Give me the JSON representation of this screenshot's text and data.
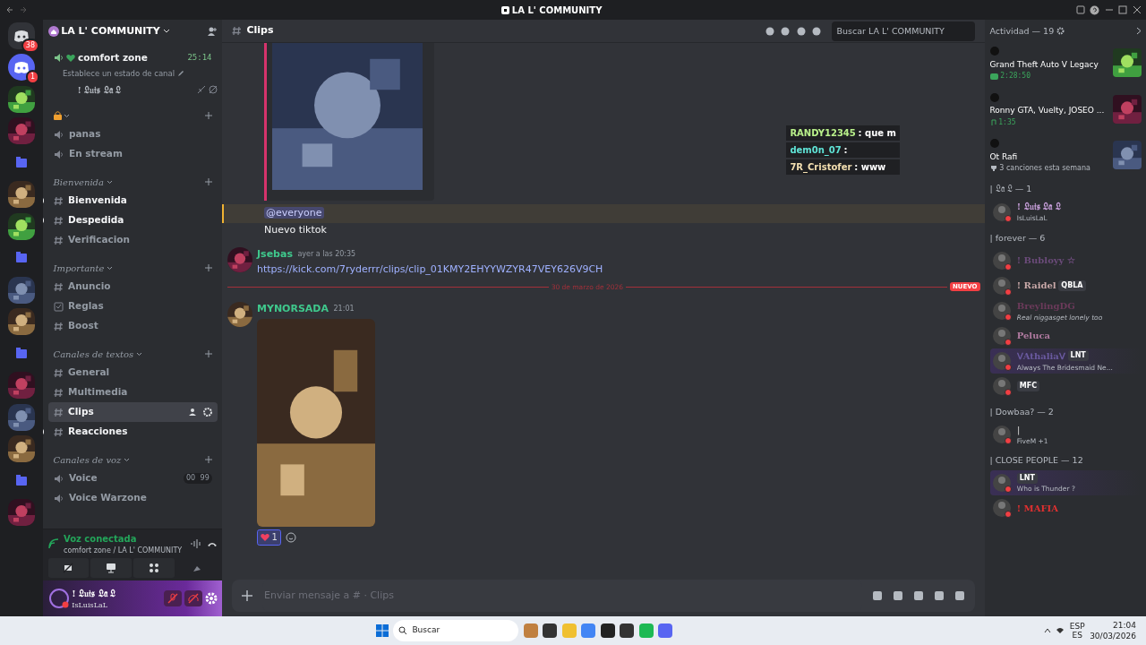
{
  "window": {
    "title": "LA L' COMMUNITY"
  },
  "servers": [
    {
      "kind": "home",
      "badge": "38"
    },
    {
      "kind": "logo",
      "badge": "1"
    },
    {
      "kind": "picture"
    },
    {
      "kind": "picture"
    },
    {
      "kind": "folder"
    },
    {
      "kind": "picture"
    },
    {
      "kind": "picture"
    },
    {
      "kind": "folder"
    },
    {
      "kind": "picture"
    },
    {
      "kind": "picture"
    },
    {
      "kind": "folder"
    },
    {
      "kind": "picture"
    },
    {
      "kind": "picture"
    },
    {
      "kind": "picture"
    },
    {
      "kind": "folder"
    },
    {
      "kind": "picture"
    }
  ],
  "server": {
    "name": "LA L' COMMUNITY"
  },
  "voice_top": {
    "channel": "comfort zone",
    "timer": "25:14",
    "hint": "Establece un estado de canal",
    "member": "! 𝔏𝔲𝔦𝔰 𝔏𝔞 𝔏"
  },
  "categories": [
    {
      "kind": "locked",
      "channels": [
        {
          "name": "panas",
          "kind": "voice",
          "unread": false,
          "selected": false
        },
        {
          "name": "En stream",
          "kind": "voice",
          "unread": false,
          "selected": false
        }
      ]
    },
    {
      "kind": "named",
      "name": "Bienvenida",
      "channels": [
        {
          "name": "Bienvenida",
          "kind": "text",
          "unread": true,
          "selected": false
        },
        {
          "name": "Despedida",
          "kind": "text",
          "unread": true,
          "selected": false
        },
        {
          "name": "Verificacion",
          "kind": "text",
          "unread": false,
          "selected": false
        }
      ]
    },
    {
      "kind": "named",
      "name": "Importante",
      "channels": [
        {
          "name": "Anuncio",
          "kind": "text",
          "unread": false,
          "selected": false
        },
        {
          "name": "Reglas",
          "kind": "rules",
          "unread": false,
          "selected": false
        },
        {
          "name": "Boost",
          "kind": "text",
          "unread": false,
          "selected": false
        }
      ]
    },
    {
      "kind": "named",
      "name": "Canales de textos",
      "channels": [
        {
          "name": "General",
          "kind": "text",
          "unread": false,
          "selected": false
        },
        {
          "name": "Multimedia",
          "kind": "text",
          "unread": false,
          "selected": false
        },
        {
          "name": "Clips",
          "kind": "text",
          "unread": false,
          "selected": true
        },
        {
          "name": "Reacciones",
          "kind": "text",
          "unread": true,
          "selected": false
        }
      ]
    },
    {
      "kind": "named",
      "name": "Canales de voz",
      "channels": [
        {
          "name": "Voice",
          "kind": "voice",
          "unread": false,
          "selected": false,
          "counter": [
            "00",
            "99"
          ]
        },
        {
          "name": "Voice Warzone",
          "kind": "voice",
          "unread": false,
          "selected": false
        }
      ]
    }
  ],
  "voice_panel": {
    "title": "Voz conectada",
    "location": "comfort zone / LA L' COMMUNITY"
  },
  "user": {
    "name": "! 𝔏𝔲𝔦𝔰 𝔏𝔞 𝔏",
    "handle": "IsLuisLaL"
  },
  "chat": {
    "channel": "Clips",
    "search_placeholder": "Buscar LA L' COMMUNITY",
    "input_placeholder": "Enviar mensaje a # · Clips",
    "messages": [
      {
        "kind": "video"
      },
      {
        "kind": "line",
        "text": "@everyone",
        "mention": true
      },
      {
        "kind": "line",
        "text": "Nuevo tiktok",
        "mention": false
      },
      {
        "kind": "post",
        "author": "Jsebas",
        "time": "ayer a las 20:35",
        "link": "https://kick.com/7ryderrr/clips/clip_01KMY2EHYYWZYR47VEY626V9CH"
      },
      {
        "kind": "divider",
        "date": "30 de marzo de 2026",
        "label": "NUEVO"
      },
      {
        "kind": "post",
        "author": "MYNORSADA",
        "time": "21:01",
        "media": true,
        "reaction": "1"
      }
    ]
  },
  "overlay": [
    {
      "user": "RANDY12345",
      "text": ": que m",
      "color": "#b8f08a"
    },
    {
      "user": "dem0n_07",
      "text": ":",
      "color": "#5fe3d6"
    },
    {
      "user": "7R_Cristofer",
      "text": ": www",
      "color": "#f3dfb0"
    }
  ],
  "members": {
    "activity_title": "Actividad — 19",
    "activities": [
      {
        "kind": "game",
        "title": "Grand Theft Auto V Legacy",
        "meta": "2:28:50"
      },
      {
        "kind": "music",
        "title": "Ronny GTA, Vuelty, JOSEO ...",
        "meta": "1:35"
      },
      {
        "kind": "trophy",
        "title": "Ot Rafi",
        "meta": "3 canciones esta semana"
      }
    ],
    "groups": [
      {
        "title": "| 𝔏𝔞 𝔏 — 1",
        "members": [
          {
            "name": "! 𝔏𝔲𝔦𝔰 𝔏𝔞 𝔏",
            "status": "IsLuisLaL",
            "color": "#c9a0dc"
          }
        ]
      },
      {
        "title": "| forever — 6",
        "members": [
          {
            "name": "! Bubloyy ☆",
            "color": "#6b4b7a"
          },
          {
            "name": "! Raidel",
            "tag": "QBLA",
            "color": "#c8a8a8"
          },
          {
            "name": "BreylingDG",
            "status": "Real niggasget lonely too",
            "color": "#6b3a5a"
          },
          {
            "name": "Peluca",
            "color": "#b07aa0"
          },
          {
            "name": "ᐯAthaliaᐯ",
            "tag": "LNT",
            "status": "Always The Bridesmaid Ne...",
            "color": "#6a5aa0"
          },
          {
            "tag": "MFC"
          }
        ]
      },
      {
        "title": "| Dowbaa? — 2",
        "members": [
          {
            "name": "|",
            "status": "FiveM +1",
            "color": "#bbbbbb"
          }
        ]
      },
      {
        "title": "| CLOSE PEOPLE — 12",
        "members": [
          {
            "tag": "LNT",
            "status": "Who is Thunder ?"
          },
          {
            "name": "! MAFIA",
            "color": "#e03030"
          }
        ]
      }
    ]
  },
  "taskbar": {
    "search": "Buscar",
    "lang": "ESP",
    "lang2": "ES",
    "time": "21:04",
    "date": "30/03/2026"
  }
}
